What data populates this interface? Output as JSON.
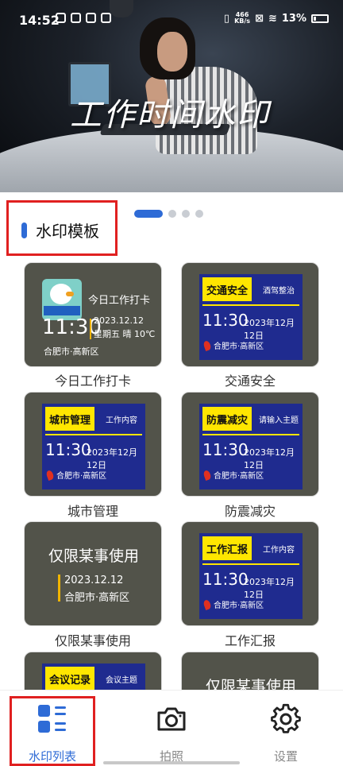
{
  "status_bar": {
    "time": "14:52",
    "net_speed_value": "466",
    "net_speed_unit": "KB/s",
    "battery": "13%"
  },
  "banner": {
    "title": "工作时间水印"
  },
  "carousel": {
    "active_index": 0,
    "count": 4
  },
  "section": {
    "title": "水印模板"
  },
  "templates": [
    {
      "label": "今日工作打卡",
      "style": "daily",
      "heading": "今日工作打卡",
      "time": "11:30",
      "date": "2023.12.12",
      "info": "星期五 晴 10℃",
      "location": "合肥市·高新区"
    },
    {
      "label": "交通安全",
      "style": "blue",
      "tag": "交通安全",
      "topic": "酒驾整治",
      "time": "11:30",
      "date": "2023年12月12日",
      "location": "合肥市·高新区"
    },
    {
      "label": "城市管理",
      "style": "blue",
      "tag": "城市管理",
      "topic": "工作内容",
      "time": "11:30",
      "date": "2023年12月12日",
      "location": "合肥市·高新区"
    },
    {
      "label": "防震减灾",
      "style": "blue",
      "tag": "防震减灾",
      "topic": "请输入主题",
      "time": "11:30",
      "date": "2023年12月12日",
      "location": "合肥市·高新区"
    },
    {
      "label": "仅限某事使用",
      "style": "limited",
      "heading": "仅限某事使用",
      "date": "2023.12.12",
      "location": "合肥市·高新区"
    },
    {
      "label": "工作汇报",
      "style": "blue",
      "tag": "工作汇报",
      "topic": "工作内容",
      "time": "11:30",
      "date": "2023年12月12日",
      "location": "合肥市·高新区"
    },
    {
      "style": "blue",
      "tag": "会议记录",
      "topic": "会议主题"
    },
    {
      "style": "limited",
      "heading": "仅限某事使用"
    }
  ],
  "bottom_nav": {
    "items": [
      {
        "label": "水印列表",
        "icon": "list-icon",
        "active": true
      },
      {
        "label": "拍照",
        "icon": "camera-icon",
        "active": false
      },
      {
        "label": "设置",
        "icon": "gear-icon",
        "active": false
      }
    ]
  },
  "colors": {
    "accent": "#2e6bd6",
    "highlight_red": "#e02020",
    "card_bg": "#52534a",
    "panel_blue": "#1f2b8f",
    "tag_yellow": "#ffe600"
  }
}
